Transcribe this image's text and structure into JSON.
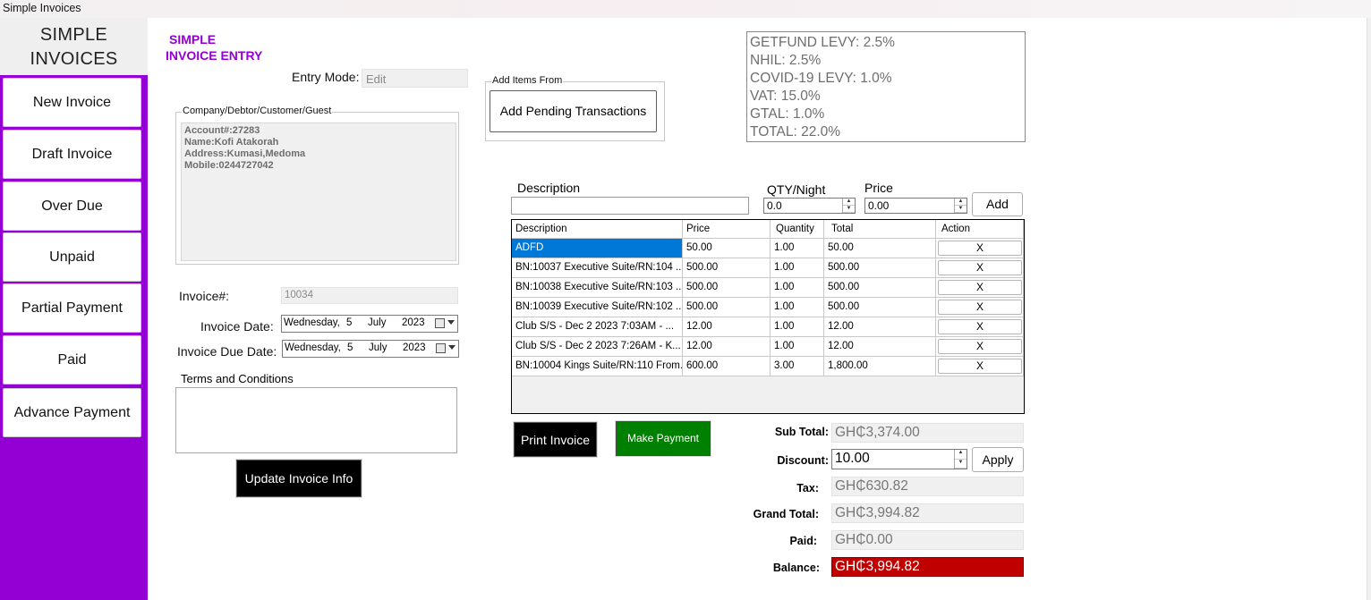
{
  "window": {
    "title": "Simple Invoices"
  },
  "sidebar": {
    "brand_line1": "SIMPLE",
    "brand_line2": "INVOICES",
    "items": [
      {
        "label": "New Invoice"
      },
      {
        "label": "Draft Invoice"
      },
      {
        "label": "Over Due"
      },
      {
        "label": "Unpaid"
      },
      {
        "label": "Partial Payment"
      },
      {
        "label": "Paid"
      },
      {
        "label": "Advance Payment"
      }
    ]
  },
  "header": {
    "title_line1": "SIMPLE",
    "title_line2": "INVOICE ENTRY"
  },
  "entry_mode": {
    "label": "Entry Mode:",
    "value": "Edit"
  },
  "customer": {
    "group_title": "Company/Debtor/Customer/Guest",
    "lines": [
      "Account#:27283",
      "Name:Kofi Atakorah",
      "Address:Kumasi,Medoma",
      "Mobile:0244727042"
    ]
  },
  "invoice": {
    "number_label": "Invoice#:",
    "number_value": "10034",
    "date_label": "Invoice Date:",
    "date": {
      "weekday": "Wednesday,",
      "day": "5",
      "month": "July",
      "year": "2023"
    },
    "due_label": "Invoice Due Date:",
    "due": {
      "weekday": "Wednesday,",
      "day": "5",
      "month": "July",
      "year": "2023"
    },
    "terms_label": "Terms and Conditions",
    "terms_value": "",
    "update_button": "Update Invoice Info"
  },
  "add_items": {
    "group_title": "Add Items From",
    "button": "Add Pending Transactions"
  },
  "taxes": {
    "lines": [
      "GETFUND LEVY: 2.5%",
      "NHIL: 2.5%",
      "COVID-19 LEVY: 1.0%",
      "VAT: 15.0%",
      "GTAL: 1.0%",
      "TOTAL: 22.0%"
    ]
  },
  "item_entry": {
    "description_label": "Description",
    "description_value": "",
    "qty_label": "QTY/Night",
    "qty_value": "0.0",
    "price_label": "Price",
    "price_value": "0.00",
    "add_button": "Add"
  },
  "grid": {
    "columns": [
      "Description",
      "Price",
      "Quantity",
      "Total",
      "Action"
    ],
    "rows": [
      {
        "description": "ADFD",
        "price": "50.00",
        "quantity": "1.00",
        "total": "50.00",
        "action": "X"
      },
      {
        "description": "BN:10037 Executive Suite/RN:104 ...",
        "price": "500.00",
        "quantity": "1.00",
        "total": "500.00",
        "action": "X"
      },
      {
        "description": "BN:10038 Executive Suite/RN:103 ...",
        "price": "500.00",
        "quantity": "1.00",
        "total": "500.00",
        "action": "X"
      },
      {
        "description": "BN:10039 Executive Suite/RN:102 ...",
        "price": "500.00",
        "quantity": "1.00",
        "total": "500.00",
        "action": "X"
      },
      {
        "description": "Club S/S - Dec  2 2023  7:03AM - ...",
        "price": "12.00",
        "quantity": "1.00",
        "total": "12.00",
        "action": "X"
      },
      {
        "description": "Club S/S - Dec  2 2023  7:26AM - K...",
        "price": "12.00",
        "quantity": "1.00",
        "total": "12.00",
        "action": "X"
      },
      {
        "description": "BN:10004 Kings Suite/RN:110 From...",
        "price": "600.00",
        "quantity": "3.00",
        "total": "1,800.00",
        "action": "X"
      }
    ]
  },
  "actions": {
    "print": "Print Invoice",
    "pay": "Make Payment"
  },
  "totals": {
    "subtotal_label": "Sub Total:",
    "subtotal": "GH₵3,374.00",
    "discount_label": "Discount:",
    "discount": "10.00",
    "apply_button": "Apply",
    "tax_label": "Tax:",
    "tax": "GH₵630.82",
    "grand_label": "Grand Total:",
    "grand": "GH₵3,994.82",
    "paid_label": "Paid:",
    "paid": "GH₵0.00",
    "balance_label": "Balance:",
    "balance": "GH₵3,994.82"
  },
  "colors": {
    "accent": "#9400d3",
    "selected_row": "#0078d7",
    "pay_button": "#008000",
    "balance_bg": "#c00000"
  }
}
